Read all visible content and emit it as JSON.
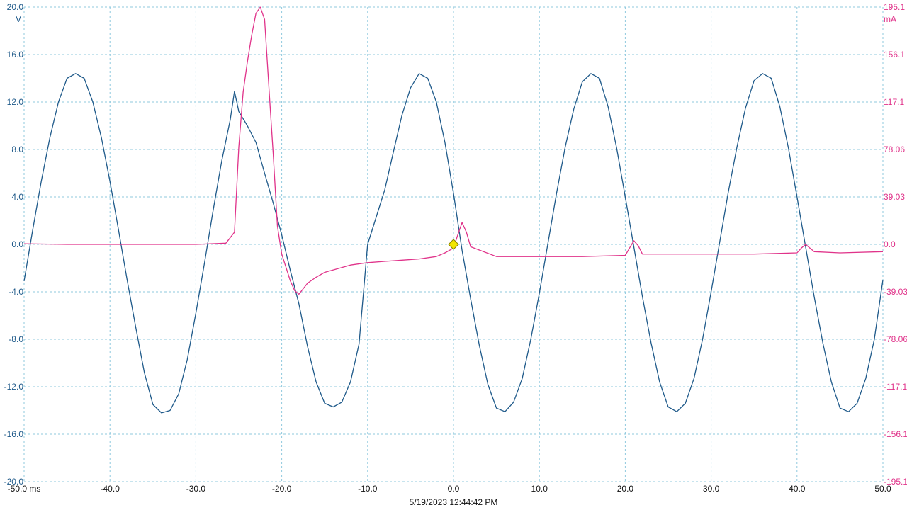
{
  "chart_data": {
    "type": "line",
    "title": "",
    "xlabel": "",
    "x_unit": "ms",
    "xlim": [
      -50,
      50
    ],
    "x_ticks": [
      -50,
      -40,
      -30,
      -20,
      -10,
      0,
      10,
      20,
      30,
      40,
      50
    ],
    "x_tick_labels": [
      "-50.0 ms",
      "-40.0",
      "-30.0",
      "-20.0",
      "-10.0",
      "0.0",
      "10.0",
      "20.0",
      "30.0",
      "40.0",
      "50.0"
    ],
    "left_axis": {
      "unit": "V",
      "ylim": [
        -20,
        20
      ],
      "ticks": [
        20,
        16,
        12,
        8,
        4,
        0,
        -4,
        -8,
        -12,
        -16,
        -20
      ],
      "tick_labels": [
        "20.0",
        "16.0",
        "12.0",
        "8.0",
        "4.0",
        "0.0",
        "-4.0",
        "-8.0",
        "-12.0",
        "-16.0",
        "-20.0"
      ],
      "color": "#1f5a8a"
    },
    "right_axis": {
      "unit": "mA",
      "ylim": [
        -195.1,
        195.1
      ],
      "ticks": [
        195.1,
        156.1,
        117.1,
        78.06,
        39.03,
        0,
        -39.03,
        -78.06,
        -117.1,
        -156.1,
        -195.1
      ],
      "tick_labels": [
        "195.1",
        "156.1",
        "117.1",
        "78.06",
        "39.03",
        "0.0",
        "-39.03",
        "-78.06",
        "-117.1",
        "-156.1",
        "-195.1"
      ],
      "color": "#e0338a"
    },
    "grid": true,
    "trigger_marker": {
      "x": 0.0,
      "y": 0.0,
      "color": "#f2e600"
    },
    "timestamp": "5/19/2023 12:44:42 PM",
    "series": [
      {
        "axis": "left",
        "color": "#1f5a8a",
        "x": [
          -50,
          -49,
          -48,
          -47,
          -46,
          -45,
          -44,
          -43,
          -42,
          -41,
          -40,
          -39,
          -38,
          -37,
          -36,
          -35,
          -34,
          -33,
          -32,
          -31,
          -30,
          -29,
          -28,
          -27,
          -26,
          -25.5,
          -25,
          -24,
          -23,
          -22,
          -21,
          -20,
          -19,
          -18,
          -17,
          -16,
          -15,
          -14,
          -13,
          -12,
          -11,
          -10,
          -9,
          -8,
          -7,
          -6,
          -5,
          -4,
          -3,
          -2,
          -1,
          0,
          1,
          2,
          3,
          4,
          5,
          6,
          7,
          8,
          9,
          10,
          11,
          12,
          13,
          14,
          15,
          16,
          17,
          18,
          19,
          20,
          21,
          22,
          23,
          24,
          25,
          26,
          27,
          28,
          29,
          30,
          31,
          32,
          33,
          34,
          35,
          36,
          37,
          38,
          39,
          40,
          41,
          42,
          43,
          44,
          45,
          46,
          47,
          48,
          49,
          50
        ],
        "y": [
          -3.1,
          1.2,
          5.3,
          9.0,
          12.0,
          14.0,
          14.4,
          14.0,
          12.0,
          9.0,
          5.3,
          1.2,
          -3.0,
          -7.0,
          -10.8,
          -13.5,
          -14.2,
          -14.0,
          -12.6,
          -9.7,
          -5.8,
          -1.6,
          2.8,
          7.0,
          10.5,
          12.9,
          11.2,
          10.0,
          8.6,
          6.0,
          3.5,
          0.8,
          -2.2,
          -5.0,
          -8.6,
          -11.6,
          -13.4,
          -13.7,
          -13.3,
          -11.6,
          -8.4,
          0.0,
          2.3,
          4.6,
          7.8,
          10.9,
          13.2,
          14.4,
          14.0,
          12.0,
          8.6,
          4.3,
          -0.5,
          -4.6,
          -8.5,
          -11.8,
          -13.8,
          -14.1,
          -13.3,
          -11.3,
          -8.0,
          -4.1,
          0.1,
          4.3,
          8.2,
          11.4,
          13.7,
          14.4,
          14.0,
          11.6,
          8.1,
          4.0,
          -0.2,
          -4.4,
          -8.3,
          -11.6,
          -13.7,
          -14.1,
          -13.4,
          -11.3,
          -8.0,
          -4.0,
          0.2,
          4.4,
          8.2,
          11.5,
          13.8,
          14.4,
          14.0,
          11.6,
          8.1,
          4.0,
          -0.2,
          -4.4,
          -8.3,
          -11.6,
          -13.8,
          -14.1,
          -13.4,
          -11.3,
          -8.0,
          -3.0
        ]
      },
      {
        "axis": "right",
        "color": "#e0338a",
        "x": [
          -50,
          -45,
          -40,
          -35,
          -30,
          -26.5,
          -25.5,
          -25,
          -24.5,
          -24,
          -23.5,
          -23,
          -22.5,
          -22,
          -21.5,
          -21,
          -20.5,
          -20,
          -19,
          -18.5,
          -18,
          -17,
          -16,
          -15,
          -14,
          -12,
          -10,
          -8,
          -6,
          -4,
          -2,
          -1,
          0,
          0.5,
          1,
          1.5,
          2,
          5,
          10,
          15,
          20,
          20.5,
          21,
          21.5,
          22,
          25,
          30,
          35,
          40,
          40.5,
          41,
          41.5,
          42,
          45,
          50
        ],
        "y": [
          0.5,
          0,
          0,
          0,
          0,
          1,
          10,
          80,
          125,
          150,
          172,
          190,
          195,
          185,
          130,
          75,
          15,
          -8,
          -30,
          -38,
          -41,
          -32,
          -27,
          -23,
          -21,
          -17,
          -15,
          -14,
          -13,
          -12,
          -10,
          -7,
          -3,
          8,
          18,
          10,
          -2,
          -10,
          -10,
          -10,
          -9,
          -3,
          3,
          -1,
          -8,
          -8,
          -8,
          -8,
          -7,
          -3,
          0,
          -3,
          -6,
          -7,
          -6
        ]
      }
    ]
  }
}
